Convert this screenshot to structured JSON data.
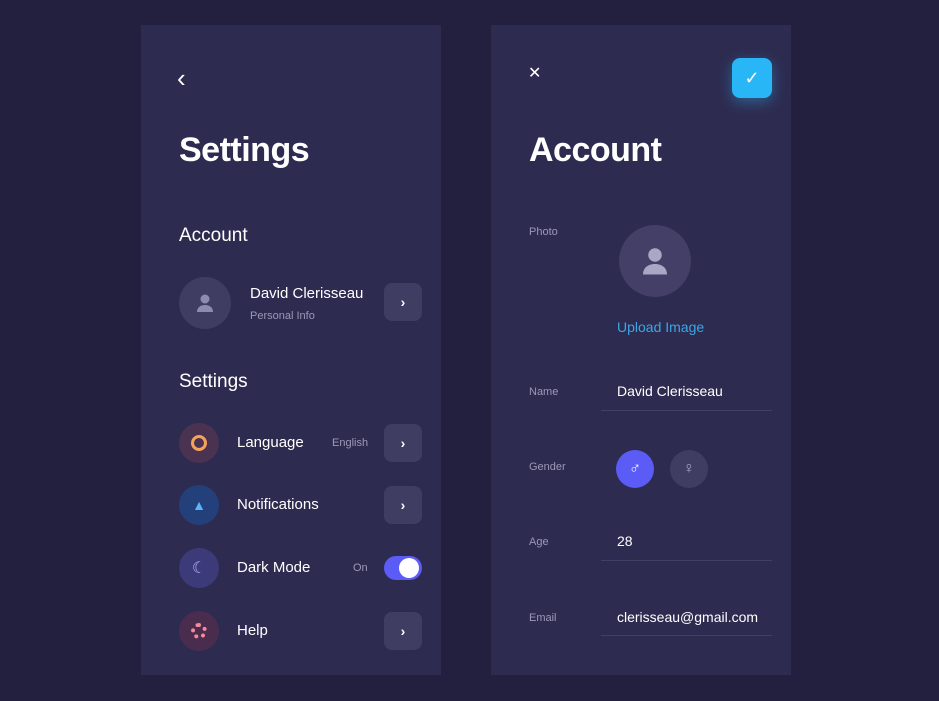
{
  "settings": {
    "title": "Settings",
    "account_heading": "Account",
    "user_name": "David Clerisseau",
    "user_sub": "Personal Info",
    "settings_heading": "Settings",
    "items": [
      {
        "label": "Language",
        "value": "English",
        "icon": "globe-icon",
        "color": "#f4a35b"
      },
      {
        "label": "Notifications",
        "value": "",
        "icon": "bell-icon",
        "color": "#5ab4f5"
      },
      {
        "label": "Dark Mode",
        "value": "On",
        "icon": "moon-icon",
        "color": "#b6b3ff"
      },
      {
        "label": "Help",
        "value": "",
        "icon": "lifebuoy-icon",
        "color": "#f38a9c"
      }
    ],
    "dark_mode_on": true
  },
  "account": {
    "title": "Account",
    "photo_label": "Photo",
    "upload": "Upload Image",
    "name_label": "Name",
    "name": "David Clerisseau",
    "gender_label": "Gender",
    "gender": "male",
    "male": "♂",
    "female": "♀",
    "age_label": "Age",
    "age": "28",
    "email_label": "Email",
    "email": "clerisseau@gmail.com"
  },
  "icons": {
    "back": "‹",
    "close": "✕",
    "check": "✓",
    "chevron": "›"
  },
  "colors": {
    "accent": "#5b5cf6",
    "confirm": "#29b6f6",
    "link": "#3aa7e6"
  }
}
